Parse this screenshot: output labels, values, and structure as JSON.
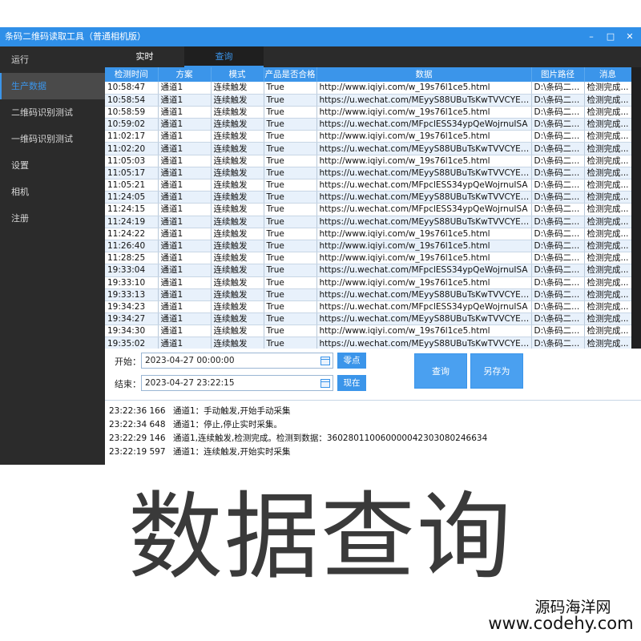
{
  "window": {
    "title": "条码二维码读取工具（普通相机版）",
    "controls": {
      "minimize": "–",
      "maximize": "□",
      "close": "✕"
    }
  },
  "sidebar": {
    "items": [
      {
        "label": "运行",
        "active": false
      },
      {
        "label": "生产数据",
        "active": true
      },
      {
        "label": "二维码识别测试",
        "active": false
      },
      {
        "label": "一维码识别测试",
        "active": false
      },
      {
        "label": "设置",
        "active": false
      },
      {
        "label": "相机",
        "active": false
      },
      {
        "label": "注册",
        "active": false
      }
    ]
  },
  "tabs": [
    {
      "label": "实时",
      "active": false
    },
    {
      "label": "查询",
      "active": true
    }
  ],
  "table": {
    "columns": [
      "检测时间",
      "方案",
      "模式",
      "产品是否合格",
      "数据",
      "图片路径",
      "消息"
    ],
    "rows": [
      [
        "10:58:47",
        "通道1",
        "连续触发",
        "True",
        "http://www.iqiyi.com/w_19s76l1ce5.html",
        "D:\\条码二...",
        "检测完成..."
      ],
      [
        "10:58:54",
        "通道1",
        "连续触发",
        "True",
        "https://u.wechat.com/MEyyS88UBuTsKwTVVCYEj...",
        "D:\\条码二...",
        "检测完成..."
      ],
      [
        "10:58:59",
        "通道1",
        "连续触发",
        "True",
        "http://www.iqiyi.com/w_19s76l1ce5.html",
        "D:\\条码二...",
        "检测完成..."
      ],
      [
        "10:59:02",
        "通道1",
        "连续触发",
        "True",
        "https://u.wechat.com/MFpclESS34ypQeWojrnuISA",
        "D:\\条码二...",
        "检测完成..."
      ],
      [
        "11:02:17",
        "通道1",
        "连续触发",
        "True",
        "http://www.iqiyi.com/w_19s76l1ce5.html",
        "D:\\条码二...",
        "检测完成..."
      ],
      [
        "11:02:20",
        "通道1",
        "连续触发",
        "True",
        "https://u.wechat.com/MEyyS88UBuTsKwTVVCYEj...",
        "D:\\条码二...",
        "检测完成..."
      ],
      [
        "11:05:03",
        "通道1",
        "连续触发",
        "True",
        "http://www.iqiyi.com/w_19s76l1ce5.html",
        "D:\\条码二...",
        "检测完成..."
      ],
      [
        "11:05:17",
        "通道1",
        "连续触发",
        "True",
        "https://u.wechat.com/MEyyS88UBuTsKwTVVCYEj...",
        "D:\\条码二...",
        "检测完成..."
      ],
      [
        "11:05:21",
        "通道1",
        "连续触发",
        "True",
        "https://u.wechat.com/MFpclESS34ypQeWojrnuISA",
        "D:\\条码二...",
        "检测完成..."
      ],
      [
        "11:24:05",
        "通道1",
        "连续触发",
        "True",
        "https://u.wechat.com/MEyyS88UBuTsKwTVVCYEj...",
        "D:\\条码二...",
        "检测完成..."
      ],
      [
        "11:24:15",
        "通道1",
        "连续触发",
        "True",
        "https://u.wechat.com/MFpclESS34ypQeWojrnuISA",
        "D:\\条码二...",
        "检测完成..."
      ],
      [
        "11:24:19",
        "通道1",
        "连续触发",
        "True",
        "https://u.wechat.com/MEyyS88UBuTsKwTVVCYEj...",
        "D:\\条码二...",
        "检测完成..."
      ],
      [
        "11:24:22",
        "通道1",
        "连续触发",
        "True",
        "http://www.iqiyi.com/w_19s76l1ce5.html",
        "D:\\条码二...",
        "检测完成..."
      ],
      [
        "11:26:40",
        "通道1",
        "连续触发",
        "True",
        "http://www.iqiyi.com/w_19s76l1ce5.html",
        "D:\\条码二...",
        "检测完成..."
      ],
      [
        "11:28:25",
        "通道1",
        "连续触发",
        "True",
        "http://www.iqiyi.com/w_19s76l1ce5.html",
        "D:\\条码二...",
        "检测完成..."
      ],
      [
        "19:33:04",
        "通道1",
        "连续触发",
        "True",
        "https://u.wechat.com/MFpclESS34ypQeWojrnuISA",
        "D:\\条码二...",
        "检测完成..."
      ],
      [
        "19:33:10",
        "通道1",
        "连续触发",
        "True",
        "http://www.iqiyi.com/w_19s76l1ce5.html",
        "D:\\条码二...",
        "检测完成..."
      ],
      [
        "19:33:13",
        "通道1",
        "连续触发",
        "True",
        "https://u.wechat.com/MEyyS88UBuTsKwTVVCYEj...",
        "D:\\条码二...",
        "检测完成..."
      ],
      [
        "19:34:23",
        "通道1",
        "连续触发",
        "True",
        "https://u.wechat.com/MFpclESS34ypQeWojrnuISA",
        "D:\\条码二...",
        "检测完成..."
      ],
      [
        "19:34:27",
        "通道1",
        "连续触发",
        "True",
        "https://u.wechat.com/MEyyS88UBuTsKwTVVCYEj...",
        "D:\\条码二...",
        "检测完成..."
      ],
      [
        "19:34:30",
        "通道1",
        "连续触发",
        "True",
        "http://www.iqiyi.com/w_19s76l1ce5.html",
        "D:\\条码二...",
        "检测完成..."
      ],
      [
        "19:35:02",
        "通道1",
        "连续触发",
        "True",
        "https://u.wechat.com/MEyyS88UBuTsKwTVVCYEj...",
        "D:\\条码二...",
        "检测完成..."
      ]
    ]
  },
  "query": {
    "start_label": "开始：",
    "start_value": "2023-04-27 00:00:00",
    "zero_button": "零点",
    "end_label": "结束：",
    "end_value": "2023-04-27 23:22:15",
    "now_button": "现在",
    "query_button": "查询",
    "save_as_button": "另存为"
  },
  "log": [
    {
      "time": "23:22:36 166",
      "msg": "通道1：手动触发,开始手动采集"
    },
    {
      "time": "23:22:34 648",
      "msg": "通道1：停止,停止实时采集。"
    },
    {
      "time": "23:22:29 146",
      "msg": "通道1,连续触发,检测完成。检测到数据：36028011006000004230308024663​4"
    },
    {
      "time": "23:22:19 597",
      "msg": "通道1：连续触发,开始实时采集"
    }
  ],
  "caption": "数据查询",
  "watermark": {
    "line1": "源码海洋网",
    "line2": "www.codehy.com"
  },
  "colors": {
    "accent": "#3b95ea",
    "titlebar": "#2f8fe8",
    "sidebar": "#2b2b2b"
  }
}
